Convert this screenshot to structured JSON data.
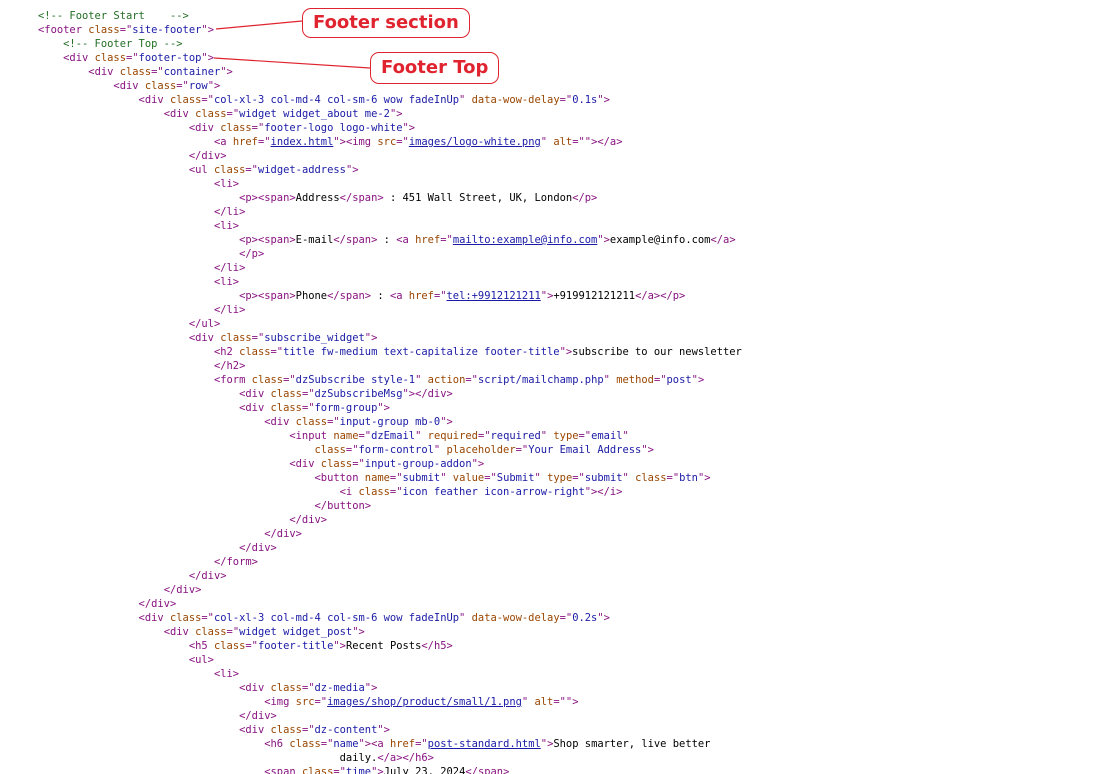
{
  "annotations": [
    {
      "label": "Footer section",
      "color": "#e0242f"
    },
    {
      "label": "Footer Top",
      "color": "#e0242f"
    }
  ],
  "syntax_colors": {
    "comment": "#236e25",
    "tag": "#881280",
    "attr_name": "#994500",
    "attr_value": "#1a1aa6",
    "text": "#000000"
  },
  "code_lines": [
    {
      "indent": 0,
      "tokens": [
        [
          "cm",
          "<!-- Footer Start    -->"
        ]
      ]
    },
    {
      "indent": 0,
      "tokens": [
        [
          "tg",
          "<footer "
        ],
        [
          "an",
          "class"
        ],
        [
          "tg",
          "=\""
        ],
        [
          "av",
          "site-footer"
        ],
        [
          "tg",
          "\">"
        ]
      ]
    },
    {
      "indent": 1,
      "tokens": [
        [
          "cm",
          "<!-- Footer Top -->"
        ]
      ]
    },
    {
      "indent": 1,
      "tokens": [
        [
          "tg",
          "<div "
        ],
        [
          "an",
          "class"
        ],
        [
          "tg",
          "=\""
        ],
        [
          "av",
          "footer-top"
        ],
        [
          "tg",
          "\">"
        ]
      ]
    },
    {
      "indent": 2,
      "tokens": [
        [
          "tg",
          "<div "
        ],
        [
          "an",
          "class"
        ],
        [
          "tg",
          "=\""
        ],
        [
          "av",
          "container"
        ],
        [
          "tg",
          "\">"
        ]
      ]
    },
    {
      "indent": 3,
      "tokens": [
        [
          "tg",
          "<div "
        ],
        [
          "an",
          "class"
        ],
        [
          "tg",
          "=\""
        ],
        [
          "av",
          "row"
        ],
        [
          "tg",
          "\">"
        ]
      ]
    },
    {
      "indent": 4,
      "tokens": [
        [
          "tg",
          "<div "
        ],
        [
          "an",
          "class"
        ],
        [
          "tg",
          "=\""
        ],
        [
          "av",
          "col-xl-3 col-md-4 col-sm-6 wow fadeInUp"
        ],
        [
          "tg",
          "\" "
        ],
        [
          "an",
          "data-wow-delay"
        ],
        [
          "tg",
          "=\""
        ],
        [
          "av",
          "0.1s"
        ],
        [
          "tg",
          "\">"
        ]
      ]
    },
    {
      "indent": 5,
      "tokens": [
        [
          "tg",
          "<div "
        ],
        [
          "an",
          "class"
        ],
        [
          "tg",
          "=\""
        ],
        [
          "av",
          "widget widget_about me-2"
        ],
        [
          "tg",
          "\">"
        ]
      ]
    },
    {
      "indent": 6,
      "tokens": [
        [
          "tg",
          "<div "
        ],
        [
          "an",
          "class"
        ],
        [
          "tg",
          "=\""
        ],
        [
          "av",
          "footer-logo logo-white"
        ],
        [
          "tg",
          "\">"
        ]
      ]
    },
    {
      "indent": 7,
      "tokens": [
        [
          "tg",
          "<a "
        ],
        [
          "an",
          "href"
        ],
        [
          "tg",
          "=\""
        ],
        [
          "lk",
          "index.html"
        ],
        [
          "tg",
          "\"><img "
        ],
        [
          "an",
          "src"
        ],
        [
          "tg",
          "=\""
        ],
        [
          "lk",
          "images/logo-white.png"
        ],
        [
          "tg",
          "\" "
        ],
        [
          "an",
          "alt"
        ],
        [
          "tg",
          "=\"\"></a>"
        ]
      ]
    },
    {
      "indent": 6,
      "tokens": [
        [
          "tg",
          "</div>"
        ]
      ]
    },
    {
      "indent": 6,
      "tokens": [
        [
          "tg",
          "<ul "
        ],
        [
          "an",
          "class"
        ],
        [
          "tg",
          "=\""
        ],
        [
          "av",
          "widget-address"
        ],
        [
          "tg",
          "\">"
        ]
      ]
    },
    {
      "indent": 7,
      "tokens": [
        [
          "tg",
          "<li>"
        ]
      ]
    },
    {
      "indent": 8,
      "tokens": [
        [
          "tg",
          "<p><span>"
        ],
        [
          "tx",
          "Address"
        ],
        [
          "tg",
          "</span>"
        ],
        [
          "tx",
          " : 451 Wall Street, UK, London"
        ],
        [
          "tg",
          "</p>"
        ]
      ]
    },
    {
      "indent": 7,
      "tokens": [
        [
          "tg",
          "</li>"
        ]
      ]
    },
    {
      "indent": 7,
      "tokens": [
        [
          "tg",
          "<li>"
        ]
      ]
    },
    {
      "indent": 8,
      "tokens": [
        [
          "tg",
          "<p><span>"
        ],
        [
          "tx",
          "E-mail"
        ],
        [
          "tg",
          "</span>"
        ],
        [
          "tx",
          " : "
        ],
        [
          "tg",
          "<a "
        ],
        [
          "an",
          "href"
        ],
        [
          "tg",
          "=\""
        ],
        [
          "lk",
          "mailto:example@info.com"
        ],
        [
          "tg",
          "\">"
        ],
        [
          "tx",
          "example@info.com"
        ],
        [
          "tg",
          "</a>"
        ]
      ]
    },
    {
      "indent": 8,
      "tokens": [
        [
          "tg",
          "</p>"
        ]
      ]
    },
    {
      "indent": 7,
      "tokens": [
        [
          "tg",
          "</li>"
        ]
      ]
    },
    {
      "indent": 7,
      "tokens": [
        [
          "tg",
          "<li>"
        ]
      ]
    },
    {
      "indent": 8,
      "tokens": [
        [
          "tg",
          "<p><span>"
        ],
        [
          "tx",
          "Phone"
        ],
        [
          "tg",
          "</span>"
        ],
        [
          "tx",
          " : "
        ],
        [
          "tg",
          "<a "
        ],
        [
          "an",
          "href"
        ],
        [
          "tg",
          "=\""
        ],
        [
          "lk",
          "tel:+9912121211"
        ],
        [
          "tg",
          "\">"
        ],
        [
          "tx",
          "+919912121211"
        ],
        [
          "tg",
          "</a></p>"
        ]
      ]
    },
    {
      "indent": 7,
      "tokens": [
        [
          "tg",
          "</li>"
        ]
      ]
    },
    {
      "indent": 6,
      "tokens": [
        [
          "tg",
          "</ul>"
        ]
      ]
    },
    {
      "indent": 6,
      "tokens": [
        [
          "tg",
          "<div "
        ],
        [
          "an",
          "class"
        ],
        [
          "tg",
          "=\""
        ],
        [
          "av",
          "subscribe_widget"
        ],
        [
          "tg",
          "\">"
        ]
      ]
    },
    {
      "indent": 7,
      "tokens": [
        [
          "tg",
          "<h2 "
        ],
        [
          "an",
          "class"
        ],
        [
          "tg",
          "=\""
        ],
        [
          "av",
          "title fw-medium text-capitalize footer-title"
        ],
        [
          "tg",
          "\">"
        ],
        [
          "tx",
          "subscribe to our newsletter"
        ]
      ]
    },
    {
      "indent": 7,
      "tokens": [
        [
          "tg",
          "</h2>"
        ]
      ]
    },
    {
      "indent": 7,
      "tokens": [
        [
          "tg",
          "<form "
        ],
        [
          "an",
          "class"
        ],
        [
          "tg",
          "=\""
        ],
        [
          "av",
          "dzSubscribe style-1"
        ],
        [
          "tg",
          "\" "
        ],
        [
          "an",
          "action"
        ],
        [
          "tg",
          "=\""
        ],
        [
          "av",
          "script/mailchamp.php"
        ],
        [
          "tg",
          "\" "
        ],
        [
          "an",
          "method"
        ],
        [
          "tg",
          "=\""
        ],
        [
          "av",
          "post"
        ],
        [
          "tg",
          "\">"
        ]
      ]
    },
    {
      "indent": 8,
      "tokens": [
        [
          "tg",
          "<div "
        ],
        [
          "an",
          "class"
        ],
        [
          "tg",
          "=\""
        ],
        [
          "av",
          "dzSubscribeMsg"
        ],
        [
          "tg",
          "\"></div>"
        ]
      ]
    },
    {
      "indent": 8,
      "tokens": [
        [
          "tg",
          "<div "
        ],
        [
          "an",
          "class"
        ],
        [
          "tg",
          "=\""
        ],
        [
          "av",
          "form-group"
        ],
        [
          "tg",
          "\">"
        ]
      ]
    },
    {
      "indent": 9,
      "tokens": [
        [
          "tg",
          "<div "
        ],
        [
          "an",
          "class"
        ],
        [
          "tg",
          "=\""
        ],
        [
          "av",
          "input-group mb-0"
        ],
        [
          "tg",
          "\">"
        ]
      ]
    },
    {
      "indent": 10,
      "tokens": [
        [
          "tg",
          "<input "
        ],
        [
          "an",
          "name"
        ],
        [
          "tg",
          "=\""
        ],
        [
          "av",
          "dzEmail"
        ],
        [
          "tg",
          "\" "
        ],
        [
          "an",
          "required"
        ],
        [
          "tg",
          "=\""
        ],
        [
          "av",
          "required"
        ],
        [
          "tg",
          "\" "
        ],
        [
          "an",
          "type"
        ],
        [
          "tg",
          "=\""
        ],
        [
          "av",
          "email"
        ],
        [
          "tg",
          "\""
        ]
      ]
    },
    {
      "indent": 11,
      "tokens": [
        [
          "an",
          "class"
        ],
        [
          "tg",
          "=\""
        ],
        [
          "av",
          "form-control"
        ],
        [
          "tg",
          "\" "
        ],
        [
          "an",
          "placeholder"
        ],
        [
          "tg",
          "=\""
        ],
        [
          "av",
          "Your Email Address"
        ],
        [
          "tg",
          "\">"
        ]
      ]
    },
    {
      "indent": 10,
      "tokens": [
        [
          "tg",
          "<div "
        ],
        [
          "an",
          "class"
        ],
        [
          "tg",
          "=\""
        ],
        [
          "av",
          "input-group-addon"
        ],
        [
          "tg",
          "\">"
        ]
      ]
    },
    {
      "indent": 11,
      "tokens": [
        [
          "tg",
          "<button "
        ],
        [
          "an",
          "name"
        ],
        [
          "tg",
          "=\""
        ],
        [
          "av",
          "submit"
        ],
        [
          "tg",
          "\" "
        ],
        [
          "an",
          "value"
        ],
        [
          "tg",
          "=\""
        ],
        [
          "av",
          "Submit"
        ],
        [
          "tg",
          "\" "
        ],
        [
          "an",
          "type"
        ],
        [
          "tg",
          "=\""
        ],
        [
          "av",
          "submit"
        ],
        [
          "tg",
          "\" "
        ],
        [
          "an",
          "class"
        ],
        [
          "tg",
          "=\""
        ],
        [
          "av",
          "btn"
        ],
        [
          "tg",
          "\">"
        ]
      ]
    },
    {
      "indent": 12,
      "tokens": [
        [
          "tg",
          "<i "
        ],
        [
          "an",
          "class"
        ],
        [
          "tg",
          "=\""
        ],
        [
          "av",
          "icon feather icon-arrow-right"
        ],
        [
          "tg",
          "\"></i>"
        ]
      ]
    },
    {
      "indent": 11,
      "tokens": [
        [
          "tg",
          "</button>"
        ]
      ]
    },
    {
      "indent": 10,
      "tokens": [
        [
          "tg",
          "</div>"
        ]
      ]
    },
    {
      "indent": 9,
      "tokens": [
        [
          "tg",
          "</div>"
        ]
      ]
    },
    {
      "indent": 8,
      "tokens": [
        [
          "tg",
          "</div>"
        ]
      ]
    },
    {
      "indent": 7,
      "tokens": [
        [
          "tg",
          "</form>"
        ]
      ]
    },
    {
      "indent": 6,
      "tokens": [
        [
          "tg",
          "</div>"
        ]
      ]
    },
    {
      "indent": 5,
      "tokens": [
        [
          "tg",
          "</div>"
        ]
      ]
    },
    {
      "indent": 4,
      "tokens": [
        [
          "tg",
          "</div>"
        ]
      ]
    },
    {
      "indent": 4,
      "tokens": [
        [
          "tg",
          "<div "
        ],
        [
          "an",
          "class"
        ],
        [
          "tg",
          "=\""
        ],
        [
          "av",
          "col-xl-3 col-md-4 col-sm-6 wow fadeInUp"
        ],
        [
          "tg",
          "\" "
        ],
        [
          "an",
          "data-wow-delay"
        ],
        [
          "tg",
          "=\""
        ],
        [
          "av",
          "0.2s"
        ],
        [
          "tg",
          "\">"
        ]
      ]
    },
    {
      "indent": 5,
      "tokens": [
        [
          "tg",
          "<div "
        ],
        [
          "an",
          "class"
        ],
        [
          "tg",
          "=\""
        ],
        [
          "av",
          "widget widget_post"
        ],
        [
          "tg",
          "\">"
        ]
      ]
    },
    {
      "indent": 6,
      "tokens": [
        [
          "tg",
          "<h5 "
        ],
        [
          "an",
          "class"
        ],
        [
          "tg",
          "=\""
        ],
        [
          "av",
          "footer-title"
        ],
        [
          "tg",
          "\">"
        ],
        [
          "tx",
          "Recent Posts"
        ],
        [
          "tg",
          "</h5>"
        ]
      ]
    },
    {
      "indent": 6,
      "tokens": [
        [
          "tg",
          "<ul>"
        ]
      ]
    },
    {
      "indent": 7,
      "tokens": [
        [
          "tg",
          "<li>"
        ]
      ]
    },
    {
      "indent": 8,
      "tokens": [
        [
          "tg",
          "<div "
        ],
        [
          "an",
          "class"
        ],
        [
          "tg",
          "=\""
        ],
        [
          "av",
          "dz-media"
        ],
        [
          "tg",
          "\">"
        ]
      ]
    },
    {
      "indent": 9,
      "tokens": [
        [
          "tg",
          "<img "
        ],
        [
          "an",
          "src"
        ],
        [
          "tg",
          "=\""
        ],
        [
          "lk",
          "images/shop/product/small/1.png"
        ],
        [
          "tg",
          "\" "
        ],
        [
          "an",
          "alt"
        ],
        [
          "tg",
          "=\"\">"
        ]
      ]
    },
    {
      "indent": 8,
      "tokens": [
        [
          "tg",
          "</div>"
        ]
      ]
    },
    {
      "indent": 8,
      "tokens": [
        [
          "tg",
          "<div "
        ],
        [
          "an",
          "class"
        ],
        [
          "tg",
          "=\""
        ],
        [
          "av",
          "dz-content"
        ],
        [
          "tg",
          "\">"
        ]
      ]
    },
    {
      "indent": 9,
      "tokens": [
        [
          "tg",
          "<h6 "
        ],
        [
          "an",
          "class"
        ],
        [
          "tg",
          "=\""
        ],
        [
          "av",
          "name"
        ],
        [
          "tg",
          "\"><a "
        ],
        [
          "an",
          "href"
        ],
        [
          "tg",
          "=\""
        ],
        [
          "lk",
          "post-standard.html"
        ],
        [
          "tg",
          "\">"
        ],
        [
          "tx",
          "Shop smarter, live better"
        ]
      ]
    },
    {
      "indent": 12,
      "tokens": [
        [
          "tx",
          "daily."
        ],
        [
          "tg",
          "</a></h6>"
        ]
      ]
    },
    {
      "indent": 9,
      "tokens": [
        [
          "tg",
          "<span "
        ],
        [
          "an",
          "class"
        ],
        [
          "tg",
          "=\""
        ],
        [
          "av",
          "time"
        ],
        [
          "tg",
          "\">"
        ],
        [
          "tx",
          "July 23, 2024"
        ],
        [
          "tg",
          "</span>"
        ]
      ]
    }
  ]
}
